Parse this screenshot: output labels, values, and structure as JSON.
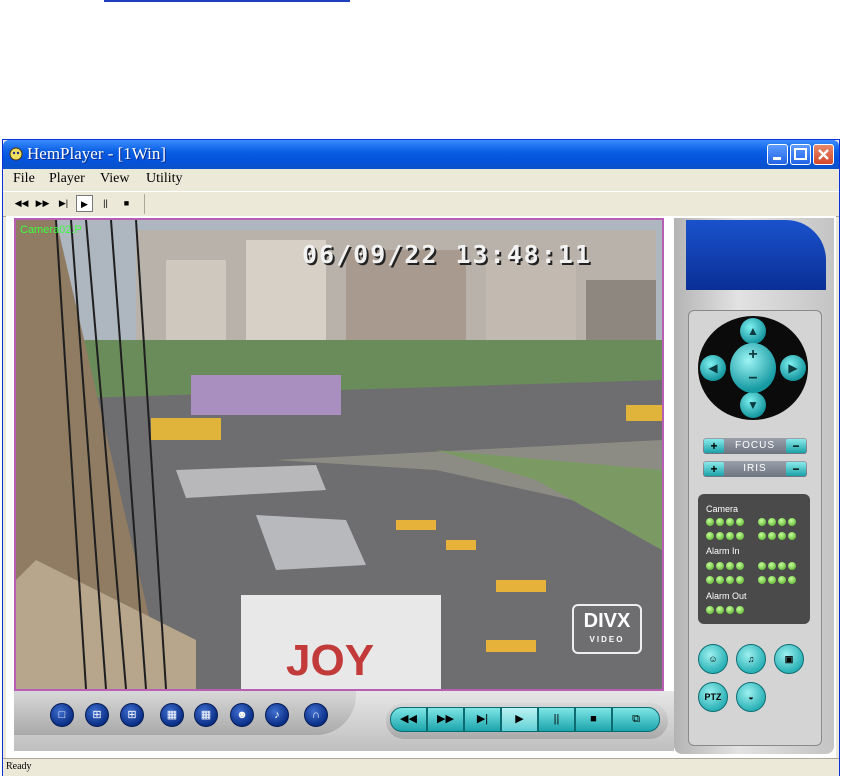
{
  "window": {
    "title": "HemPlayer - [1Win]"
  },
  "menu": {
    "items": [
      "File",
      "Player",
      "View",
      "Utility"
    ]
  },
  "toolbar": {
    "buttons": [
      {
        "icon": "rewind-icon",
        "glyph": "◀◀"
      },
      {
        "icon": "fast-forward-icon",
        "glyph": "▶▶"
      },
      {
        "icon": "step-icon",
        "glyph": "▶|"
      },
      {
        "icon": "play-icon",
        "glyph": "▶",
        "active": true
      },
      {
        "icon": "pause-icon",
        "glyph": "||"
      },
      {
        "icon": "stop-icon",
        "glyph": "■"
      }
    ]
  },
  "video": {
    "camera_label": "Camera02.P",
    "timestamp": "06/09/22 13:48:11",
    "watermark_main": "DIVX",
    "watermark_sub": "VIDEO"
  },
  "view_buttons": [
    {
      "icon": "layout-1-icon",
      "glyph": "□"
    },
    {
      "icon": "layout-4-icon",
      "glyph": "⊞"
    },
    {
      "icon": "layout-9-icon",
      "glyph": "⊞"
    },
    {
      "icon": "layout-16-icon",
      "glyph": "▦"
    },
    {
      "icon": "layout-custom-icon",
      "glyph": "▦"
    },
    {
      "icon": "person-icon",
      "glyph": "☻"
    },
    {
      "icon": "microphone-icon",
      "glyph": "♪"
    },
    {
      "icon": "headphones-icon",
      "glyph": "∩"
    }
  ],
  "playback_buttons": [
    {
      "icon": "rewind-icon",
      "glyph": "◀◀"
    },
    {
      "icon": "fast-forward-icon",
      "glyph": "▶▶"
    },
    {
      "icon": "step-icon",
      "glyph": "▶|"
    },
    {
      "icon": "play-icon",
      "glyph": "▶",
      "active": true
    },
    {
      "icon": "pause-icon",
      "glyph": "||"
    },
    {
      "icon": "stop-icon",
      "glyph": "■"
    },
    {
      "icon": "copy-icon",
      "glyph": "⧉"
    }
  ],
  "ptz": {
    "focus_label": "FOCUS",
    "iris_label": "IRIS",
    "plus": "+",
    "minus": "−"
  },
  "status_panel": {
    "camera_label": "Camera",
    "alarm_in_label": "Alarm In",
    "alarm_out_label": "Alarm Out"
  },
  "control_buttons": {
    "ptz_label": "PTZ"
  },
  "statusbar": {
    "text": "Ready"
  }
}
